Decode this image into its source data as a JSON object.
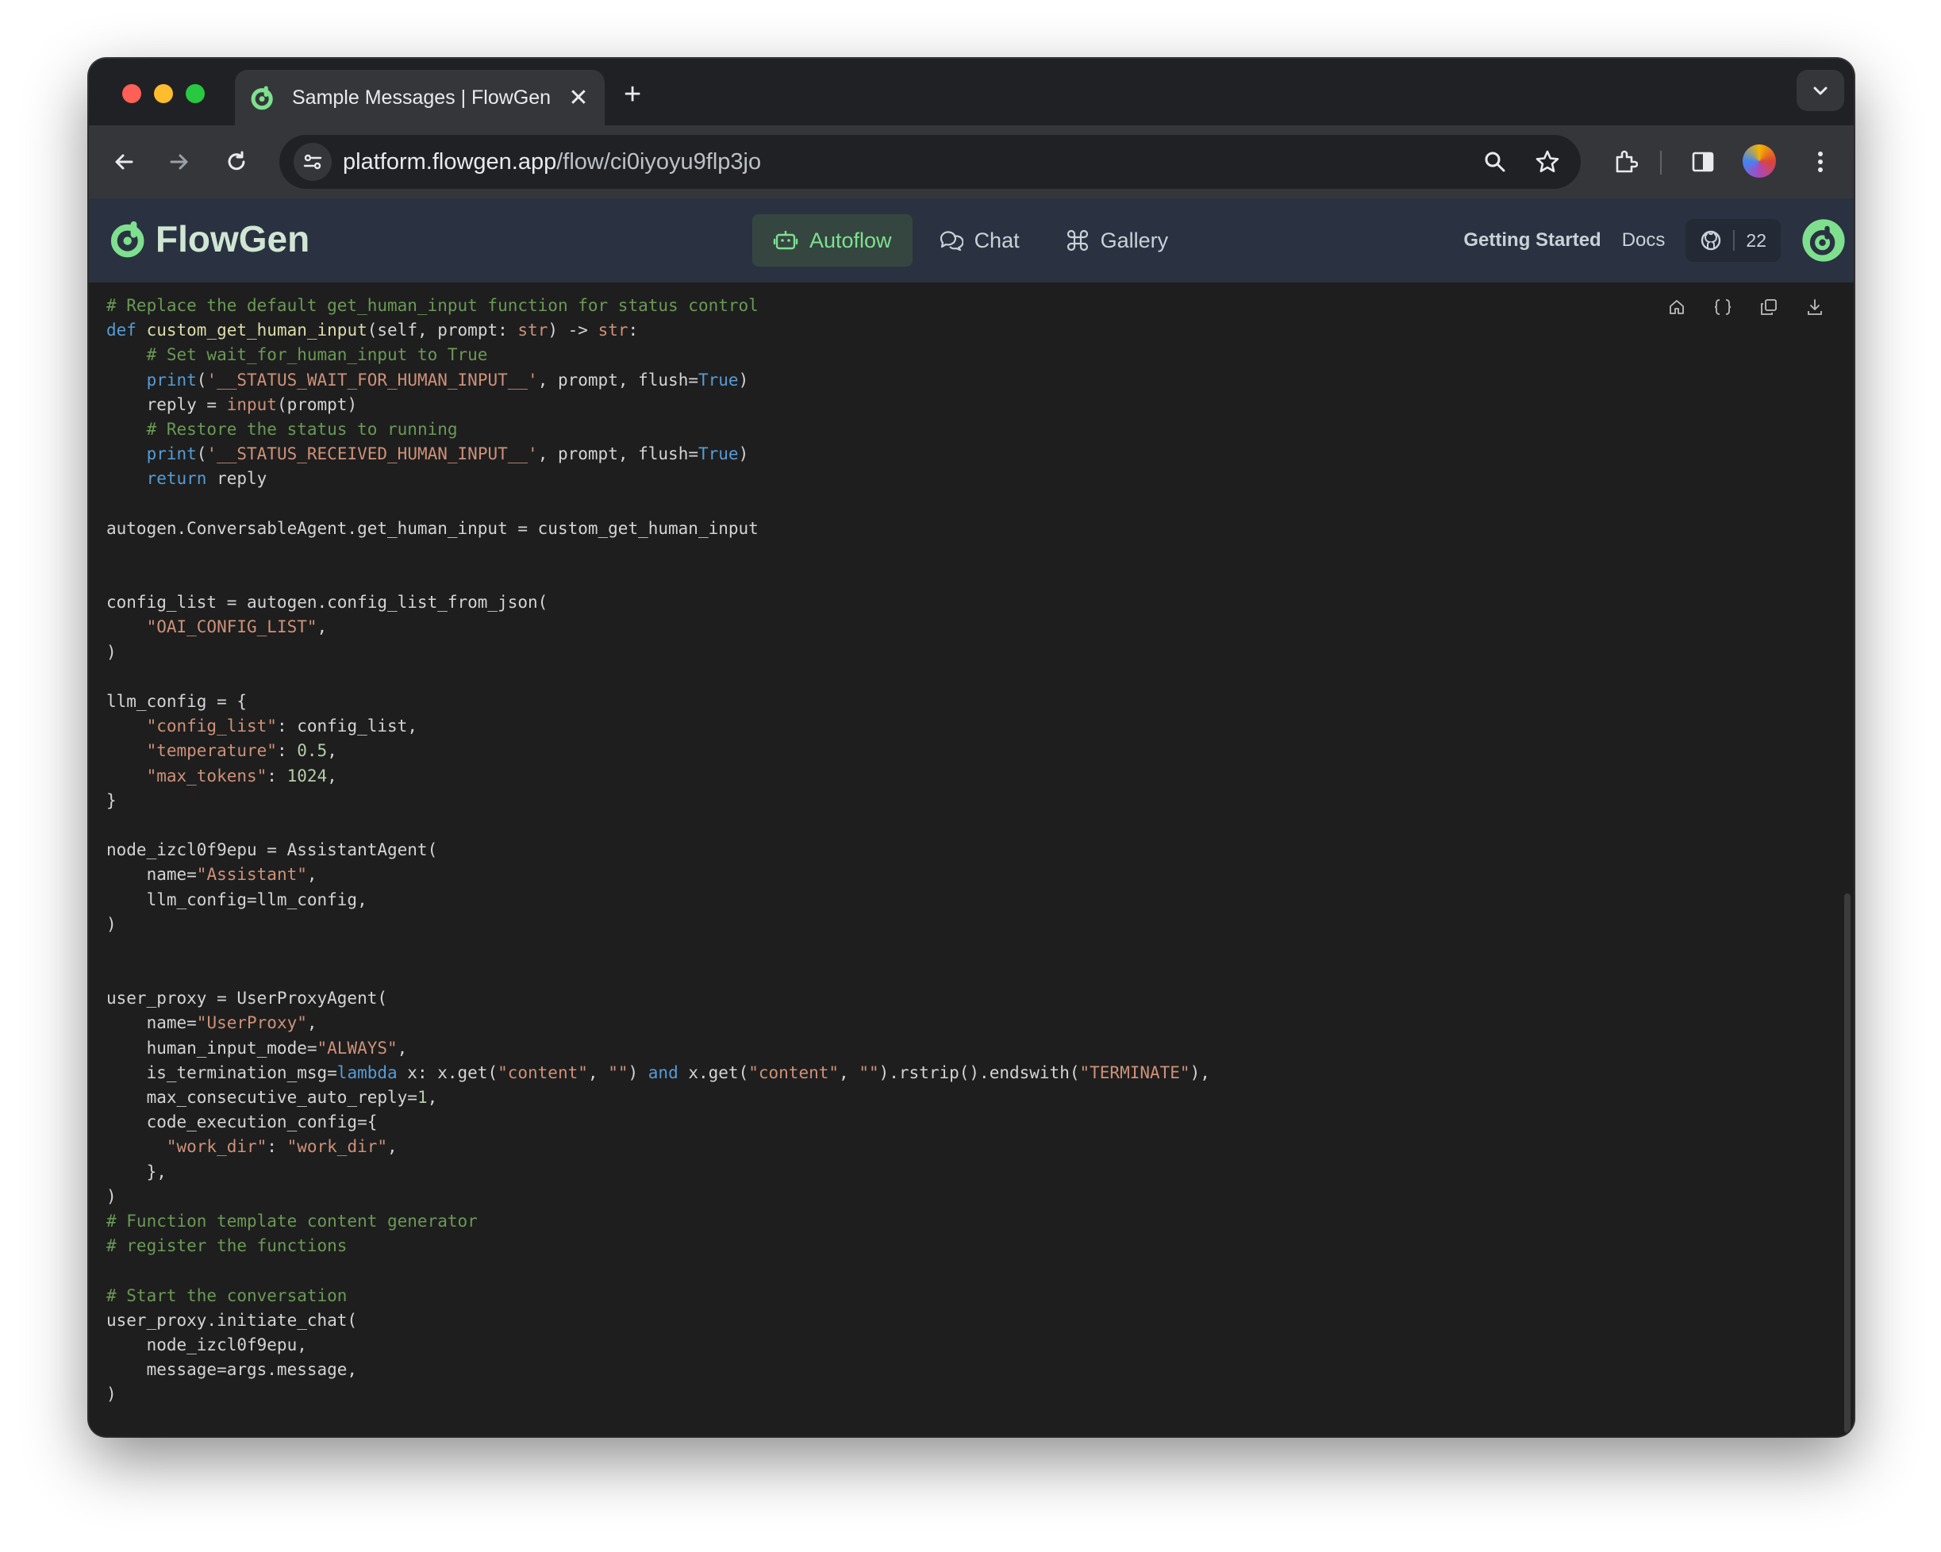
{
  "browser": {
    "tab_title": "Sample Messages | FlowGen",
    "url_host": "platform.flowgen.app",
    "url_path": "/flow/ci0iyoyu9flp3jo"
  },
  "header": {
    "brand": "FlowGen",
    "nav": [
      {
        "label": "Autoflow",
        "icon": "robot-icon",
        "active": true
      },
      {
        "label": "Chat",
        "icon": "chat-bubbles-icon",
        "active": false
      },
      {
        "label": "Gallery",
        "icon": "command-icon",
        "active": false
      }
    ],
    "getting_started": "Getting Started",
    "docs": "Docs",
    "github_stars": "22"
  },
  "colors": {
    "accent": "#7ee08f",
    "header_bg": "#2a3140",
    "code_bg": "#1e1e1e"
  },
  "code": {
    "language": "python",
    "lines": [
      [
        [
          "c-com",
          "# Replace the default get_human_input function for status control"
        ]
      ],
      [
        [
          "c-kw",
          "def"
        ],
        [
          "",
          " "
        ],
        [
          "c-fn",
          "custom_get_human_input"
        ],
        [
          "",
          "(self, prompt: "
        ],
        [
          "c-str",
          "str"
        ],
        [
          "",
          ") -> "
        ],
        [
          "c-str",
          "str"
        ],
        [
          "",
          ":"
        ]
      ],
      [
        [
          "",
          "    "
        ],
        [
          "c-com",
          "# Set wait_for_human_input to True"
        ]
      ],
      [
        [
          "",
          "    "
        ],
        [
          "c-kw",
          "print"
        ],
        [
          "",
          "("
        ],
        [
          "c-str",
          "'__STATUS_WAIT_FOR_HUMAN_INPUT__'"
        ],
        [
          "",
          ", prompt, flush="
        ],
        [
          "c-kw",
          "True"
        ],
        [
          "",
          ")"
        ]
      ],
      [
        [
          "",
          "    reply = "
        ],
        [
          "c-str",
          "input"
        ],
        [
          "",
          "(prompt)"
        ]
      ],
      [
        [
          "",
          "    "
        ],
        [
          "c-com",
          "# Restore the status to running"
        ]
      ],
      [
        [
          "",
          "    "
        ],
        [
          "c-kw",
          "print"
        ],
        [
          "",
          "("
        ],
        [
          "c-str",
          "'__STATUS_RECEIVED_HUMAN_INPUT__'"
        ],
        [
          "",
          ", prompt, flush="
        ],
        [
          "c-kw",
          "True"
        ],
        [
          "",
          ")"
        ]
      ],
      [
        [
          "",
          "    "
        ],
        [
          "c-kw",
          "return"
        ],
        [
          "",
          " reply"
        ]
      ],
      [
        [
          "",
          ""
        ]
      ],
      [
        [
          "",
          "autogen.ConversableAgent.get_human_input = custom_get_human_input"
        ]
      ],
      [
        [
          "",
          ""
        ]
      ],
      [
        [
          "",
          ""
        ]
      ],
      [
        [
          "",
          "config_list = autogen.config_list_from_json("
        ]
      ],
      [
        [
          "",
          "    "
        ],
        [
          "c-str",
          "\"OAI_CONFIG_LIST\""
        ],
        [
          "",
          ","
        ]
      ],
      [
        [
          "",
          ")"
        ]
      ],
      [
        [
          "",
          ""
        ]
      ],
      [
        [
          "",
          "llm_config = {"
        ]
      ],
      [
        [
          "",
          "    "
        ],
        [
          "c-str",
          "\"config_list\""
        ],
        [
          "",
          ": config_list,"
        ]
      ],
      [
        [
          "",
          "    "
        ],
        [
          "c-str",
          "\"temperature\""
        ],
        [
          "",
          ": "
        ],
        [
          "c-num",
          "0.5"
        ],
        [
          "",
          ","
        ]
      ],
      [
        [
          "",
          "    "
        ],
        [
          "c-str",
          "\"max_tokens\""
        ],
        [
          "",
          ": "
        ],
        [
          "c-num",
          "1024"
        ],
        [
          "",
          ","
        ]
      ],
      [
        [
          "",
          "}"
        ]
      ],
      [
        [
          "",
          ""
        ]
      ],
      [
        [
          "",
          "node_izcl0f9epu = AssistantAgent("
        ]
      ],
      [
        [
          "",
          "    name="
        ],
        [
          "c-str",
          "\"Assistant\""
        ],
        [
          "",
          ","
        ]
      ],
      [
        [
          "",
          "    llm_config=llm_config,"
        ]
      ],
      [
        [
          "",
          ")"
        ]
      ],
      [
        [
          "",
          ""
        ]
      ],
      [
        [
          "",
          ""
        ]
      ],
      [
        [
          "",
          "user_proxy = UserProxyAgent("
        ]
      ],
      [
        [
          "",
          "    name="
        ],
        [
          "c-str",
          "\"UserProxy\""
        ],
        [
          "",
          ","
        ]
      ],
      [
        [
          "",
          "    human_input_mode="
        ],
        [
          "c-str",
          "\"ALWAYS\""
        ],
        [
          "",
          ","
        ]
      ],
      [
        [
          "",
          "    is_termination_msg="
        ],
        [
          "c-kw",
          "lambda"
        ],
        [
          "",
          " x: x.get("
        ],
        [
          "c-str",
          "\"content\""
        ],
        [
          "",
          ", "
        ],
        [
          "c-str",
          "\"\""
        ],
        [
          "",
          ") "
        ],
        [
          "c-kw",
          "and"
        ],
        [
          "",
          " x.get("
        ],
        [
          "c-str",
          "\"content\""
        ],
        [
          "",
          ", "
        ],
        [
          "c-str",
          "\"\""
        ],
        [
          "",
          ").rstrip().endswith("
        ],
        [
          "c-str",
          "\"TERMINATE\""
        ],
        [
          "",
          "),"
        ]
      ],
      [
        [
          "",
          "    max_consecutive_auto_reply="
        ],
        [
          "c-num",
          "1"
        ],
        [
          "",
          ","
        ]
      ],
      [
        [
          "",
          "    code_execution_config={"
        ]
      ],
      [
        [
          "",
          "      "
        ],
        [
          "c-str",
          "\"work_dir\""
        ],
        [
          "",
          ": "
        ],
        [
          "c-str",
          "\"work_dir\""
        ],
        [
          "",
          ","
        ]
      ],
      [
        [
          "",
          "    },"
        ]
      ],
      [
        [
          "",
          ")"
        ]
      ],
      [
        [
          "c-com",
          "# Function template content generator"
        ]
      ],
      [
        [
          "c-com",
          "# register the functions"
        ]
      ],
      [
        [
          "",
          ""
        ]
      ],
      [
        [
          "c-com",
          "# Start the conversation"
        ]
      ],
      [
        [
          "",
          "user_proxy.initiate_chat("
        ]
      ],
      [
        [
          "",
          "    node_izcl0f9epu,"
        ]
      ],
      [
        [
          "",
          "    message=args.message,"
        ]
      ],
      [
        [
          "",
          ")"
        ]
      ]
    ]
  }
}
